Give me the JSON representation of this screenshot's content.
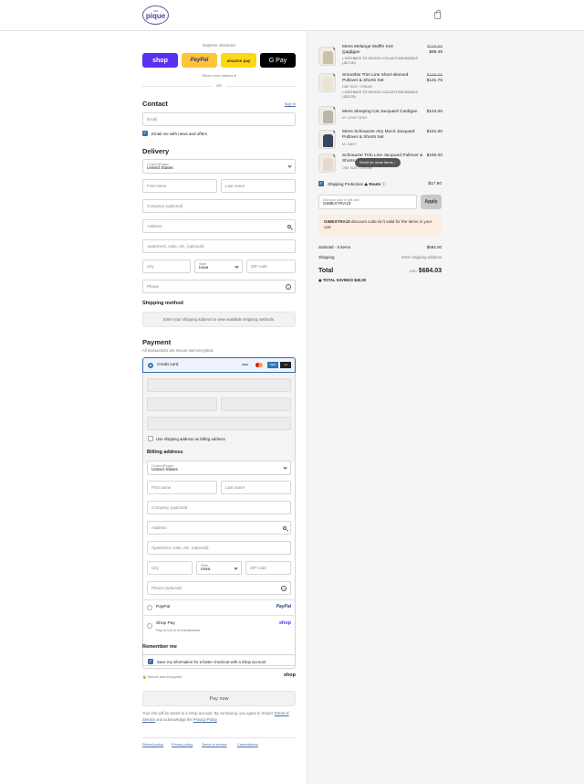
{
  "header": {
    "logo_text": "pique",
    "logo_sub": "LIFE",
    "cart_icon": "bag-icon"
  },
  "express": {
    "title": "Express checkout",
    "buttons": [
      {
        "label": "shop",
        "color": "#5a31f4"
      },
      {
        "label": "PayPal",
        "color": "#ffc439"
      },
      {
        "label": "amazon pay",
        "color": "#ffd814"
      },
      {
        "label": "G Pay",
        "color": "#000000"
      }
    ],
    "show_more": "Show more options ▾",
    "or": "OR"
  },
  "contact": {
    "heading": "Contact",
    "sign_in": "Sign in",
    "email_placeholder": "Email",
    "news_label": "Email me with news and offers"
  },
  "delivery": {
    "heading": "Delivery",
    "country_label": "Country/Region",
    "country_value": "United States",
    "first_name": "First name",
    "last_name": "Last name",
    "company": "Company (optional)",
    "address": "Address",
    "apartment": "Apartment, suite, etc. (optional)",
    "city": "City",
    "state_label": "State",
    "state_value": "Iowa",
    "zip": "ZIP code",
    "phone": "Phone"
  },
  "shipping_method": {
    "heading": "Shipping method",
    "info": "Enter your shipping address to view available shipping methods."
  },
  "payment": {
    "heading": "Payment",
    "subtitle": "All transactions are secure and encrypted.",
    "credit_card": "Credit card",
    "card_marks": [
      {
        "label": "VISA",
        "color": "#ffffff"
      },
      {
        "label": "MC",
        "color": "#ffffff"
      },
      {
        "label": "AMEX",
        "color": "#2e77bc"
      },
      {
        "label": "+3",
        "color": "#222222"
      }
    ],
    "use_shipping": "Use shipping address as billing address",
    "paypal": "PayPal",
    "paypal_logo": "PayPal",
    "shop_pay": "Shop Pay",
    "shop_pay_sub": "Pay in full or in installments",
    "shop_logo": "shop"
  },
  "billing": {
    "heading": "Billing address",
    "country_label": "Country/Region",
    "country_value": "United States",
    "first_name": "First name",
    "last_name": "Last name",
    "company": "Company (optional)",
    "address": "Address",
    "apartment": "Apartment, suite, etc. (optional)",
    "city": "City",
    "state_label": "State",
    "state_value": "Iowa",
    "zip": "ZIP code",
    "phone": "Phone (optional)"
  },
  "remember": {
    "heading": "Remember me",
    "save_label": "Save my information for a faster checkout with a Shop account",
    "secure": "Secure and encrypted",
    "shop_logo": "shop"
  },
  "pay_now": "Pay now",
  "legal": {
    "line1": "Your info will be saved to a Shop account. By continuing, you agree to Shop's",
    "terms": "Terms of Service",
    "mid": "and acknowledge the",
    "privacy": "Privacy Policy",
    "end": "."
  },
  "footer_links": [
    "Refund policy",
    "Privacy policy",
    "Terms of service",
    "Cancellations"
  ],
  "cart": {
    "items": [
      {
        "qty": "1",
        "name": "Mens Melange Waffle Knit Cardigan",
        "variant": "M / MINT",
        "bundle": "2023 BACK TO SCHOOL COLLECTION BUNDLE (-$17.00)",
        "old_price": "$116.55",
        "price": "$99.45",
        "color": "#c9c2a9"
      },
      {
        "qty": "1",
        "name": "Smoothie Trim Line Short-sleeved Pullover & Shorts Set",
        "variant": "ONE SIZE / CREAM",
        "bundle": "2023 BACK TO SCHOOL COLLECTION BUNDLE (-$23.25)",
        "old_price": "$155.00",
        "price": "$131.75",
        "color": "#ece3d2"
      },
      {
        "qty": "1",
        "name": "Mens Sleeping Cat Jacquard Cardigan",
        "variant": "M / LIGHT GRAY",
        "bundle": "",
        "old_price": "",
        "price": "$124.00",
        "color": "#b9b5ab"
      },
      {
        "qty": "1",
        "name": "Mens Schnauzer Airy Mocó Jacquard Pullover & Shorts Set",
        "variant": "M / NAVY",
        "bundle": "",
        "old_price": "",
        "price": "$161.00",
        "color": "#3a4660"
      },
      {
        "qty": "1",
        "name": "Schnauzer Trim Line Jacquard Pullover & Shorts Set",
        "variant": "ONE SIZE / CREAM",
        "bundle": "",
        "old_price": "",
        "price": "$150.00",
        "color": "#e6d9cf"
      }
    ],
    "scroll_hint": "Scroll for more items",
    "protection_label": "Shipping Protection",
    "protection_brand": "Route",
    "protection_price": "$17.60",
    "discount_label": "Discount code or gift card",
    "discount_value": "GIMEXTRA10",
    "apply": "Apply",
    "error_code": "GIMEXTRA10",
    "error_text": "discount code isn't valid for the items in your cart",
    "subtotal_label": "Subtotal · 6 items",
    "subtotal": "$684.00",
    "shipping_label": "Shipping",
    "shipping_value": "Enter shipping address",
    "total_label": "Total",
    "currency": "USD",
    "total": "$684.03",
    "savings_label": "TOTAL SAVINGS",
    "savings": "$40.00"
  }
}
